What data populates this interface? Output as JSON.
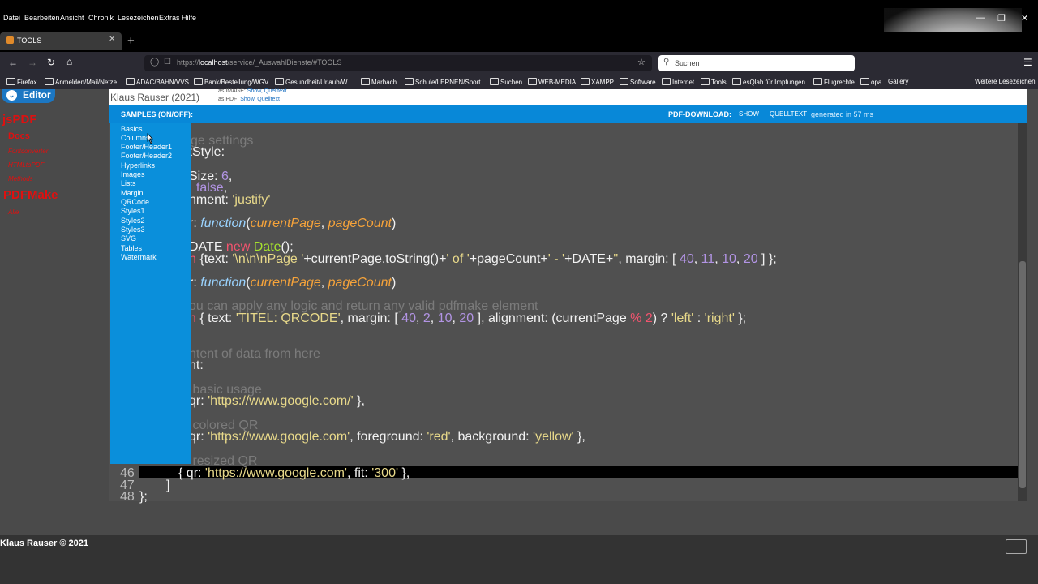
{
  "browser": {
    "menu": [
      "Datei",
      "Bearbeiten",
      "Ansicht",
      "Chronik",
      "Lesezeichen",
      "Extras",
      "Hilfe"
    ],
    "tab_title": "TOOLS",
    "url_prefix": "https://",
    "url_host": "localhost",
    "url_path": "/service/_AuswahlDienste/#TOOLS",
    "search_placeholder": "Suchen",
    "bookmarks": [
      "Firefox",
      "Anmelden/Mail/Netze",
      "ADAC/BAHN/VVS",
      "Bank/Bestellung/WGV",
      "Gesundheit/Urlaub/W...",
      "Marbach",
      "Schule/LERNEN/Sport...",
      "Suchen",
      "WEB-MEDIA",
      "XAMPP",
      "Software",
      "Internet",
      "Tools",
      "esQlab für Impfungen",
      "Flugrechte",
      "opa",
      "Gallery",
      "Weitere Lesezeichen"
    ]
  },
  "nav": {
    "editor_label": "Editor",
    "jspdf": "jsPDF",
    "docs": "Docs",
    "fontconverter": "Fontconverter",
    "html2pdf": "HTMLtoPDF",
    "methods": "Methods",
    "pdfmake": "PDFMake",
    "alle": "Alle"
  },
  "header": {
    "title": "Klaus Rauser (2021)",
    "image_label": "as IMAGE:",
    "image_links": "Show, Quelltext",
    "pdf_label": "as PDF:",
    "pdf_links": "Show, Quelltext"
  },
  "toolbar": {
    "samples": "SAMPLES (ON/OFF):",
    "pdf_download": "PDF-DOWNLOAD:",
    "show": "SHOW",
    "quelltext": "QUELLTEXT",
    "generated": "generated in 57 ms"
  },
  "samples": [
    "Basics",
    "Columns",
    "Footer/Header1",
    "Footer/Header2",
    "Hyperlinks",
    "Images",
    "Lists",
    "Margin",
    "QRCode",
    "Styles1",
    "Styles2",
    "Styles3",
    "SVG",
    "Tables",
    "Watermark"
  ],
  "code": {
    "l1_com": "ge settings",
    "l2": "ltStyle:",
    "l3_a": "Size: ",
    "l3_n": "6",
    "l3_b": ",",
    "l4_a": ": ",
    "l4_k": "false",
    "l4_b": ",",
    "l5_a": "nment: ",
    "l5_s": "'justify'",
    "l6_a": "r: ",
    "l6_k": "function",
    "l6_b": "(",
    "l6_p1": "currentPage",
    "l6_c": ", ",
    "l6_p2": "pageCount",
    "l6_d": ")",
    "l7_a": "DATE",
    "l7_n": " new ",
    "l7_f": "Date",
    "l7_b": "();",
    "l8_r": "n",
    "l8_a": " {text: ",
    "l8_s1": "'\\n\\n\\nPage '",
    "l8_b": "+currentPage.toString()+",
    "l8_s2": "' of '",
    "l8_c": "+pageCount+",
    "l8_s3": "' - '",
    "l8_d": "+DATE+",
    "l8_s4": "''",
    "l8_e": ", margin: [ ",
    "l8_n1": "40",
    "l8_f": ", ",
    "l8_n2": "11",
    "l8_g": ", ",
    "l8_n3": "10",
    "l8_h": ", ",
    "l8_n4": "20",
    "l8_i": " ] };",
    "l9_a": "r: ",
    "l9_k": "function",
    "l9_b": "(",
    "l9_p1": "currentPage",
    "l9_c": ", ",
    "l9_p2": "pageCount",
    "l9_d": ")",
    "l10_com": "ou can apply any logic and return any valid pdfmake element",
    "l11_r": "n",
    "l11_a": " { text: ",
    "l11_s": "'TITEL: QRCODE'",
    "l11_b": ", margin: [ ",
    "l11_n1": "40",
    "l11_c": ", ",
    "l11_n2": "2",
    "l11_d": ", ",
    "l11_n3": "10",
    "l11_e": ", ",
    "l11_n4": "20",
    "l11_f": " ], alignment: (currentPage ",
    "l11_r2": "% 2",
    "l11_g": ") ? ",
    "l11_s2": "'left'",
    "l11_h": " : ",
    "l11_s3": "'right'",
    "l11_i": " };",
    "l12_com": "ntent of data from here",
    "l13": "nt:",
    "l14_com": " basic usage",
    "l15_a": "qr: ",
    "l15_s": "'https://www.google.com/'",
    "l15_b": " },",
    "l16_com": " colored QR",
    "l17_a": "qr: ",
    "l17_s": "'https://www.google.com'",
    "l17_b": ", foreground: ",
    "l17_s2": "'red'",
    "l17_c": ", background: ",
    "l17_s3": "'yellow'",
    "l17_d": " },",
    "l18_com": " resized QR",
    "l46_a": "{ qr: ",
    "l46_s": "'https://www.google.com'",
    "l46_b": ", fit: ",
    "l46_s2": "'300'",
    "l46_c": " },",
    "l47": "]",
    "l48": "};",
    "gutter": [
      "46",
      "47",
      "48"
    ]
  },
  "footer": {
    "copyright": "Klaus Rauser © 2021"
  }
}
